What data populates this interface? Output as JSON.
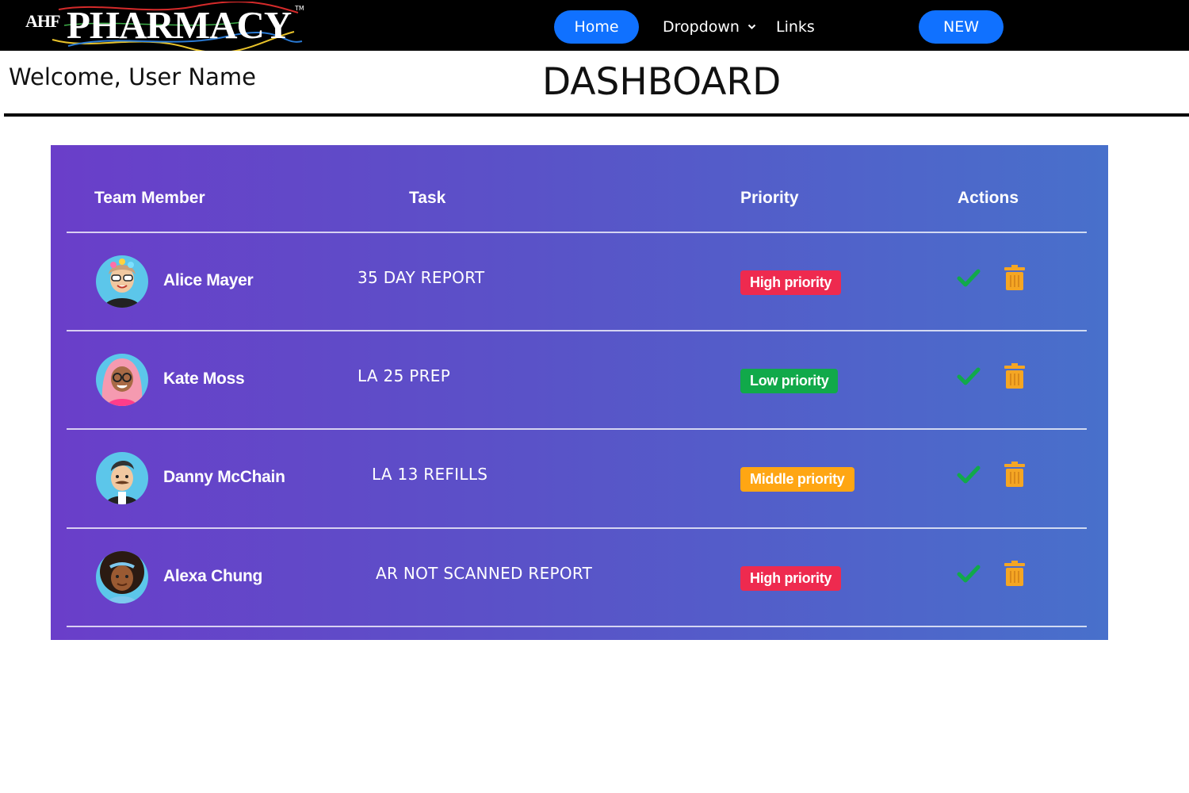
{
  "nav": {
    "logo_small": "AHF",
    "logo_big": "PHARMACY",
    "logo_tm": "TM",
    "home_label": "Home",
    "dropdown_label": "Dropdown",
    "links_label": "Links",
    "new_label": "NEW"
  },
  "header": {
    "welcome": "Welcome, User Name",
    "title": "DASHBOARD"
  },
  "table": {
    "columns": [
      "Team Member",
      "Task",
      "Priority",
      "Actions"
    ],
    "rows": [
      {
        "member": "Alice Mayer",
        "task": "35 DAY REPORT",
        "priority": "High priority",
        "priority_color": "#ee2a4f",
        "avatar": "avatar-alice"
      },
      {
        "member": "Kate Moss",
        "task": "LA 25 PREP",
        "priority": "Low priority",
        "priority_color": "#11a94a",
        "avatar": "avatar-kate"
      },
      {
        "member": "Danny McChain",
        "task": "LA 13 REFILLS",
        "priority": "Middle priority",
        "priority_color": "#ffa613",
        "avatar": "avatar-danny"
      },
      {
        "member": "Alexa Chung",
        "task": "AR NOT SCANNED REPORT",
        "priority": "High priority",
        "priority_color": "#ee2a4f",
        "avatar": "avatar-alexa"
      }
    ]
  },
  "icons": {
    "approve": "check-icon",
    "delete": "trash-icon"
  },
  "colors": {
    "nav_button": "#1071ff",
    "panel_start": "#6a3ec9",
    "panel_end": "#4870cb",
    "check": "#11a94a",
    "trash": "#f5a623"
  }
}
